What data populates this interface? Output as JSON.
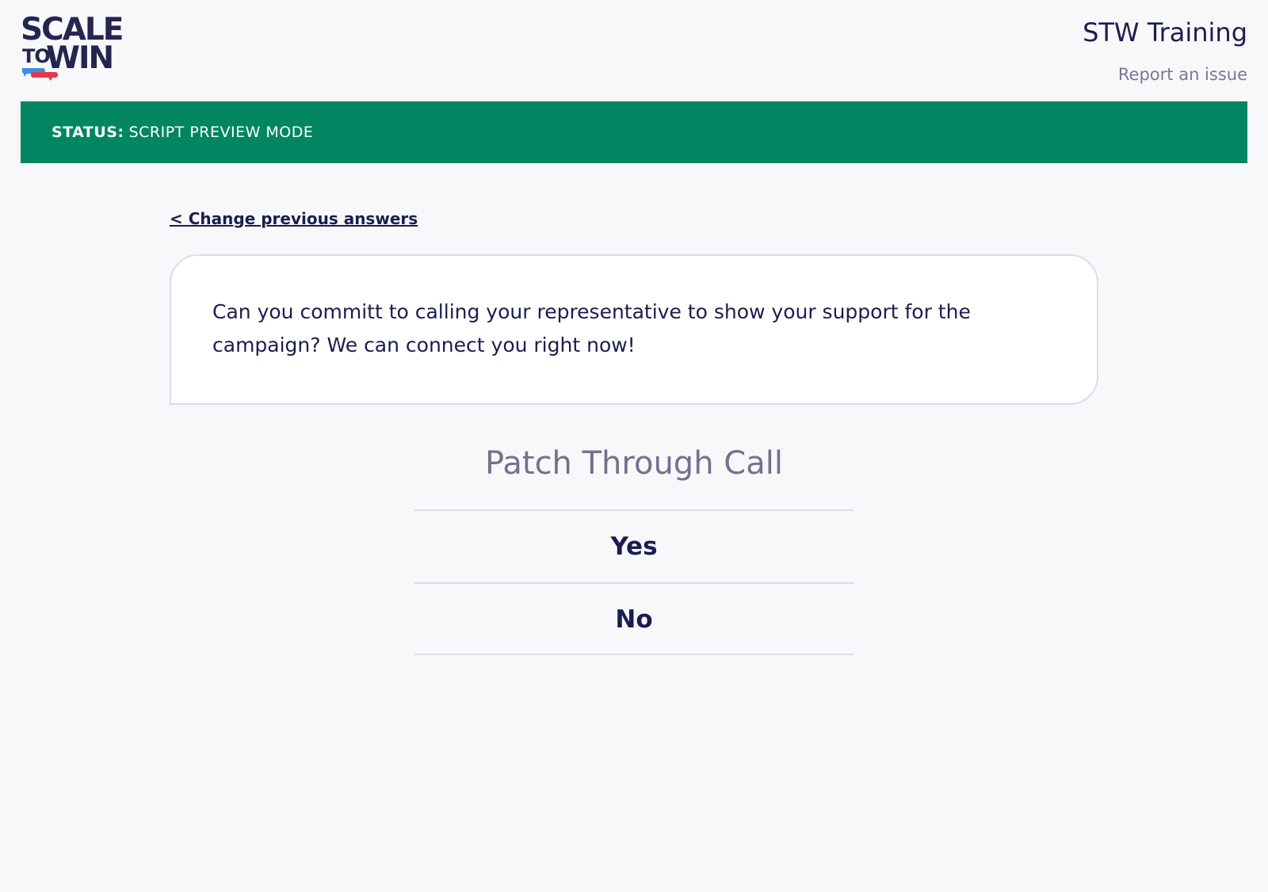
{
  "brand": {
    "logo_line1": "SCALE",
    "logo_to": "TO",
    "logo_win": "WIN",
    "bubble_colors": [
      "#3b8ee8",
      "#e8374a"
    ]
  },
  "header": {
    "org_name": "STW Training",
    "report_link": "Report an issue"
  },
  "status": {
    "label": "STATUS:",
    "value": "SCRIPT PREVIEW MODE",
    "color": "#028662"
  },
  "main": {
    "back_link": "< Change previous answers",
    "script_text": "Can you committ to calling your representative to show your support for the campaign? We can connect you right now!",
    "question_title": "Patch Through Call",
    "answers": [
      {
        "label": "Yes"
      },
      {
        "label": "No"
      }
    ]
  }
}
